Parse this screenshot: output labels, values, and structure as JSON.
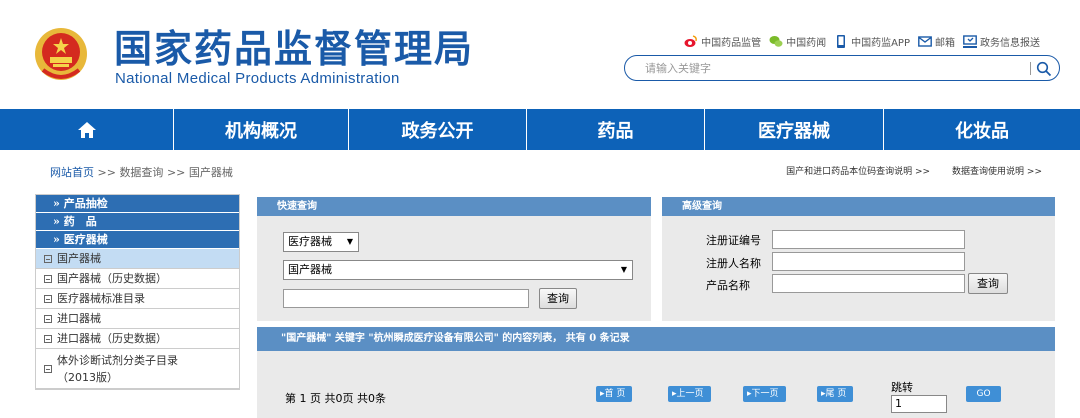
{
  "header": {
    "title_cn": "国家药品监督管理局",
    "title_en": "National Medical Products Administration",
    "links": [
      {
        "label": "中国药品监管",
        "icon": "weibo-icon"
      },
      {
        "label": "中国药闻",
        "icon": "wechat-icon"
      },
      {
        "label": "中国药监APP",
        "icon": "mobile-icon"
      },
      {
        "label": "邮箱",
        "icon": "mail-icon"
      },
      {
        "label": "政务信息报送",
        "icon": "report-icon"
      }
    ],
    "search_placeholder": "请输入关键字"
  },
  "nav": {
    "home_icon": "home-icon",
    "items": [
      "机构概况",
      "政务公开",
      "药品",
      "医疗器械",
      "化妆品"
    ]
  },
  "breadcrumb": {
    "home": "网站首页",
    "sep": ">>",
    "level2": "数据查询",
    "level3": "国产器械"
  },
  "guides": [
    "国产和进口药品本位码查询说明 >>",
    "数据查询使用说明 >>"
  ],
  "sidebar": {
    "headers": [
      "» 产品抽检",
      "» 药　品",
      "» 医疗器械"
    ],
    "items": [
      {
        "label": "国产器械",
        "active": true
      },
      {
        "label": "国产器械（历史数据）",
        "active": false
      },
      {
        "label": "医疗器械标准目录",
        "active": false
      },
      {
        "label": "进口器械",
        "active": false
      },
      {
        "label": "进口器械（历史数据）",
        "active": false
      },
      {
        "label": "体外诊断试剂分类子目录（2013版）",
        "active": false
      }
    ]
  },
  "quick_search": {
    "title": "快速查询",
    "category_select": "医疗器械",
    "database_select": "国产器械",
    "keyword_value": "",
    "search_button": "查询"
  },
  "advanced_search": {
    "title": "高级查询",
    "fields": [
      "注册证编号",
      "注册人名称",
      "产品名称"
    ],
    "search_button": "查询"
  },
  "results": {
    "header": "\"国产器械\" 关键字 \"杭州瞬成医疗设备有限公司\" 的内容列表， 共有 0 条记录",
    "page_info": "第 1 页 共0页 共0条",
    "first": "首 页",
    "prev": "上一页",
    "next": "下一页",
    "last": "尾 页",
    "jump_label": "跳转",
    "jump_value": "1",
    "go": "GO"
  },
  "colors": {
    "brand": "#1a5aa8",
    "nav": "#0d62b8",
    "panel_header": "#5b8fc4",
    "active": "#c3dcf3"
  }
}
